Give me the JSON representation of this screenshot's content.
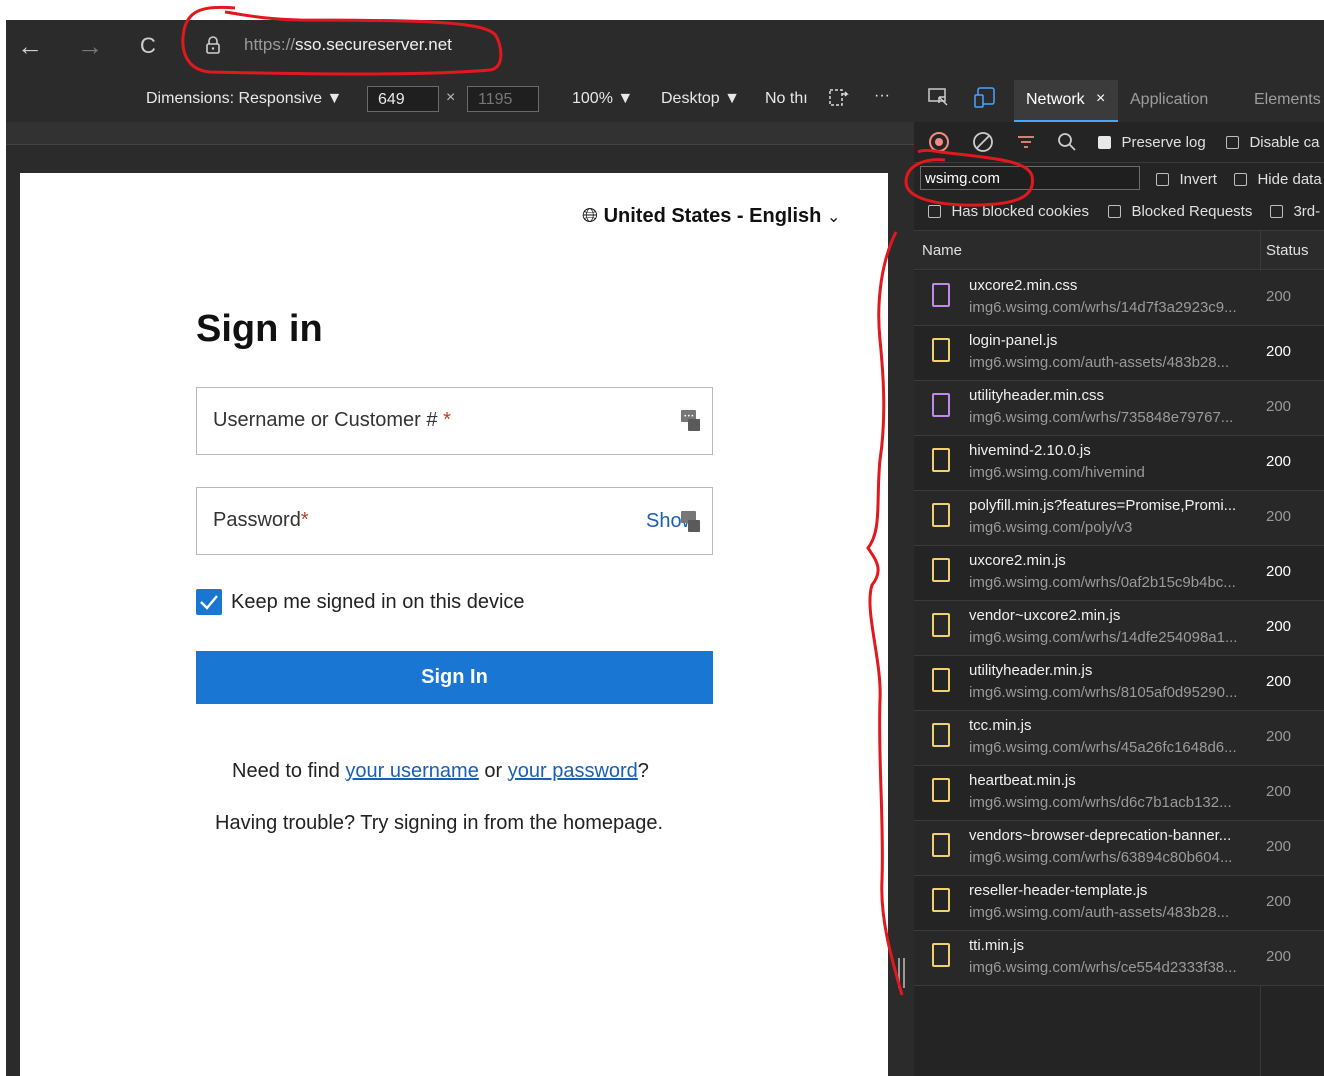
{
  "browser": {
    "back": "←",
    "forward": "→",
    "reload": "C",
    "url_scheme": "https://",
    "url_host": "sso.secureserver.net"
  },
  "device_toolbar": {
    "dimensions_label": "Dimensions: Responsive",
    "width": "649",
    "times": "×",
    "height_placeholder": "1195",
    "zoom": "100%",
    "device_mode": "Desktop",
    "throttle": "No thı",
    "more": "···"
  },
  "devtools": {
    "tabs": [
      "Network",
      "Application",
      "Elements"
    ],
    "active_tab": "Network",
    "close_tab": "×",
    "preserve_log": "Preserve log",
    "disable_cache": "Disable ca",
    "filter_value": "wsimg.com",
    "invert": "Invert",
    "hide_data": "Hide data",
    "has_blocked_cookies": "Has blocked cookies",
    "blocked_requests": "Blocked Requests",
    "third_party": "3rd-",
    "col_name": "Name",
    "col_status": "Status",
    "requests": [
      {
        "name": "uxcore2.min.css",
        "url": "img6.wsimg.com/wrhs/14d7f3a2923c9...",
        "status": "200",
        "kind": "css",
        "bright": false
      },
      {
        "name": "login-panel.js",
        "url": "img6.wsimg.com/auth-assets/483b28...",
        "status": "200",
        "kind": "js",
        "bright": true
      },
      {
        "name": "utilityheader.min.css",
        "url": "img6.wsimg.com/wrhs/735848e79767...",
        "status": "200",
        "kind": "css",
        "bright": false
      },
      {
        "name": "hivemind-2.10.0.js",
        "url": "img6.wsimg.com/hivemind",
        "status": "200",
        "kind": "js",
        "bright": true
      },
      {
        "name": "polyfill.min.js?features=Promise,Promi...",
        "url": "img6.wsimg.com/poly/v3",
        "status": "200",
        "kind": "js",
        "bright": false
      },
      {
        "name": "uxcore2.min.js",
        "url": "img6.wsimg.com/wrhs/0af2b15c9b4bc...",
        "status": "200",
        "kind": "js",
        "bright": true
      },
      {
        "name": "vendor~uxcore2.min.js",
        "url": "img6.wsimg.com/wrhs/14dfe254098a1...",
        "status": "200",
        "kind": "js",
        "bright": true
      },
      {
        "name": "utilityheader.min.js",
        "url": "img6.wsimg.com/wrhs/8105af0d95290...",
        "status": "200",
        "kind": "js",
        "bright": true
      },
      {
        "name": "tcc.min.js",
        "url": "img6.wsimg.com/wrhs/45a26fc1648d6...",
        "status": "200",
        "kind": "js",
        "bright": false
      },
      {
        "name": "heartbeat.min.js",
        "url": "img6.wsimg.com/wrhs/d6c7b1acb132...",
        "status": "200",
        "kind": "js",
        "bright": false
      },
      {
        "name": "vendors~browser-deprecation-banner...",
        "url": "img6.wsimg.com/wrhs/63894c80b604...",
        "status": "200",
        "kind": "js",
        "bright": false
      },
      {
        "name": "reseller-header-template.js",
        "url": "img6.wsimg.com/auth-assets/483b28...",
        "status": "200",
        "kind": "js",
        "bright": false
      },
      {
        "name": "tti.min.js",
        "url": "img6.wsimg.com/wrhs/ce554d2333f38...",
        "status": "200",
        "kind": "js",
        "bright": false
      }
    ]
  },
  "page": {
    "locale": "United States - English",
    "locale_chevron": "⌄",
    "title": "Sign in",
    "username_label": "Username or Customer #",
    "password_label": "Password",
    "required_mark": "*",
    "show": "Show",
    "keep_signed_in": "Keep me signed in on this device",
    "keep_signed_in_checked": true,
    "sign_in_button": "Sign In",
    "need_find_prefix": "Need to find ",
    "username_link": "your username",
    "or": " or ",
    "password_link": "your password",
    "question": "?",
    "trouble": "Having trouble? Try signing in from the homepage."
  },
  "colors": {
    "accent_blue": "#1976d2",
    "annotation_red": "#e0191e",
    "devtools_bg": "#242424"
  }
}
